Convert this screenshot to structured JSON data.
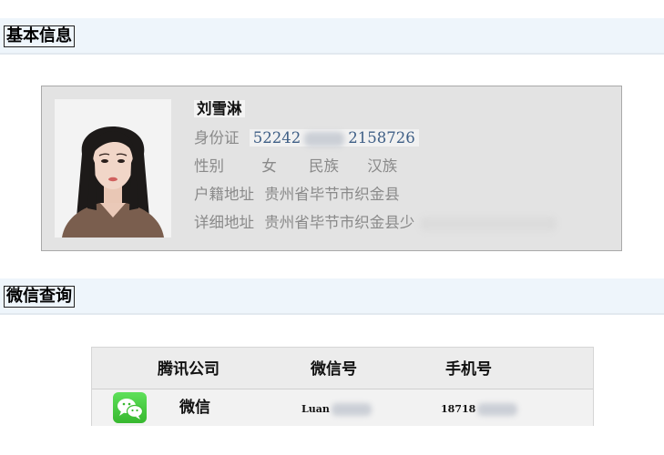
{
  "basic_section": {
    "title": "基本信息"
  },
  "person": {
    "name": "刘雪淋",
    "id_label": "身份证",
    "id_number_prefix": "52242",
    "id_number_suffix": "2158726",
    "gender_label": "性别",
    "gender": "女",
    "ethnicity_label": "民族",
    "ethnicity": "汉族",
    "household_label": "户籍地址",
    "household_address": "贵州省毕节市织金县",
    "detail_label": "详细地址",
    "detail_address": "贵州省毕节市织金县少"
  },
  "wechat_section": {
    "title": "微信查询"
  },
  "wechat_table": {
    "headers": [
      "腾讯公司",
      "微信号",
      "手机号"
    ],
    "row": {
      "icon": "wechat-icon",
      "app": "微信",
      "wechat_id_prefix": "Luan",
      "phone_prefix": "18718"
    }
  },
  "colors": {
    "section_bar": "#eef5fb",
    "card_bg": "#e3e3e3",
    "id_number": "#3f5f86",
    "wechat_green": "#37b82f"
  }
}
